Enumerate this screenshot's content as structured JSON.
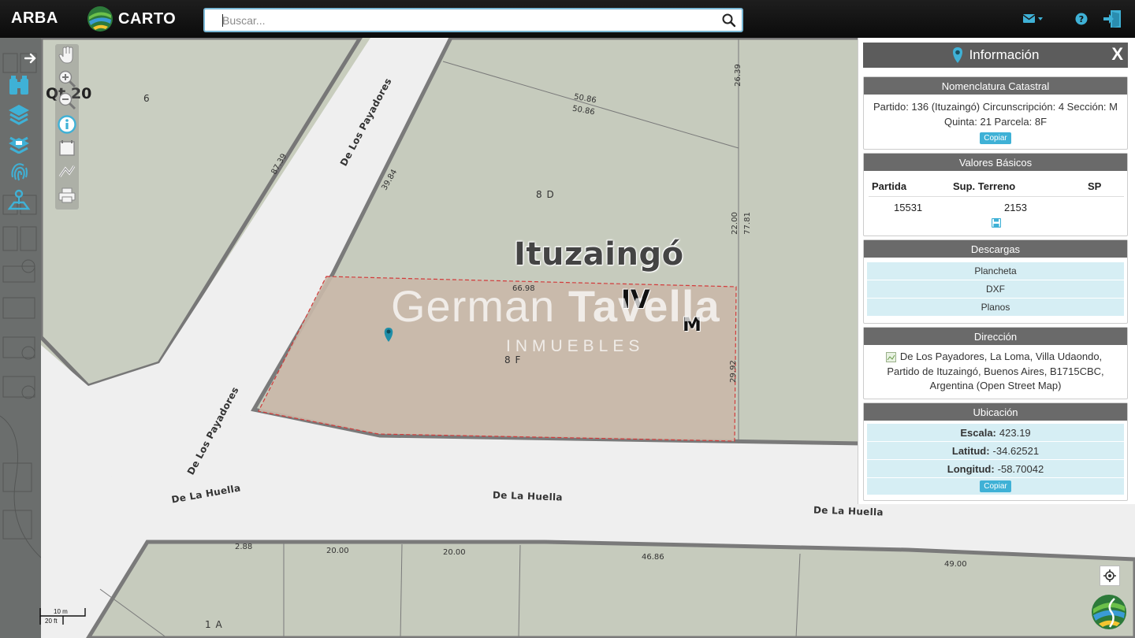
{
  "header": {
    "brand": "ARBA",
    "carto": "CARTO",
    "search_placeholder": "Buscar..."
  },
  "map": {
    "qt_label": "Qt 20",
    "lot_labels": [
      "6",
      "8 D",
      "8 F",
      "1 A"
    ],
    "block_labels": [
      "IV",
      "M"
    ],
    "city": "Ituzaingó",
    "streets": [
      "De Los Payadores",
      "De Los Payadores",
      "De La Huella",
      "De La Huella",
      "De La Huella"
    ],
    "dimensions": [
      "50.86",
      "50.86",
      "26.39",
      "87.39",
      "39.84",
      "22.00",
      "77.81",
      "66.98",
      "29.92",
      "2.88",
      "20.00",
      "20.00",
      "46.86",
      "49.00"
    ],
    "scale_top": "10 m",
    "scale_bottom": "20 ft"
  },
  "watermark": {
    "name_light": "German",
    "name_bold": "Tavella",
    "sub": "INMUEBLES"
  },
  "panel": {
    "title": "Información",
    "close": "X",
    "nomenclatura": {
      "title": "Nomenclatura Catastral",
      "line1": "Partido: 136 (Ituzaingó) Circunscripción: 4 Sección: M",
      "line2": "Quinta: 21 Parcela: 8F",
      "copy": "Copiar"
    },
    "valores": {
      "title": "Valores Básicos",
      "headers": [
        "Partida",
        "Sup. Terreno",
        "SP"
      ],
      "partida": "15531",
      "sup_terreno": "2153"
    },
    "descargas": {
      "title": "Descargas",
      "items": [
        "Plancheta",
        "DXF",
        "Planos"
      ]
    },
    "direccion": {
      "title": "Dirección",
      "line1": "De Los Payadores, La Loma, Villa Udaondo,",
      "line2": "Partido de Ituzaingó, Buenos Aires, B1715CBC,",
      "line3": "Argentina (Open Street Map)"
    },
    "ubicacion": {
      "title": "Ubicación",
      "escala_label": "Escala:",
      "escala": "423.19",
      "latitud_label": "Latitud:",
      "latitud": "-34.62521",
      "longitud_label": "Longitud:",
      "longitud": "-58.70042",
      "copy": "Copiar"
    }
  },
  "colors": {
    "accent": "#3fb1d6",
    "parcel_highlight": "#c9b8a8",
    "map_base": "#c8cdbd",
    "road": "#efefef"
  },
  "icons": [
    "search-icon",
    "mail-icon",
    "help-icon",
    "logout-icon",
    "arrow-right-icon",
    "binoculars-icon",
    "layers-icon",
    "layers-extra-icon",
    "fingerprint-icon",
    "location-person-icon",
    "hand-icon",
    "zoom-in-icon",
    "zoom-out-icon",
    "info-icon",
    "select-icon",
    "measure-icon",
    "print-icon",
    "map-pin-icon",
    "save-icon",
    "locate-icon"
  ]
}
